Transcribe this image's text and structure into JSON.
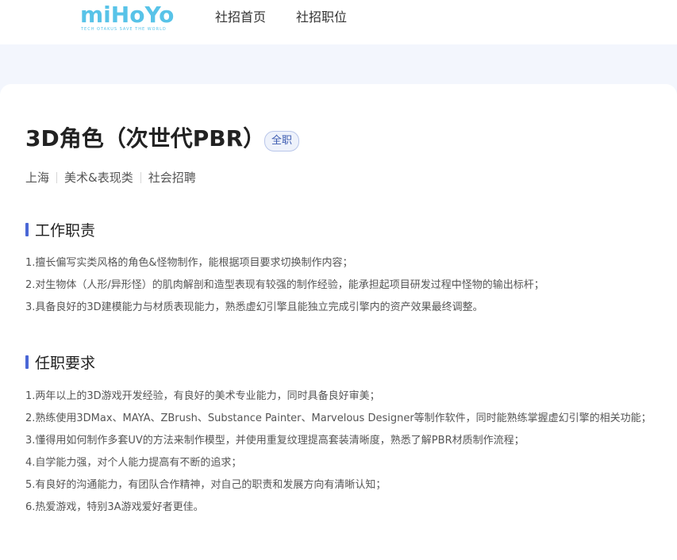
{
  "header": {
    "logo_text": "miHoYo",
    "logo_slogan": "TECH OTAKUS SAVE THE WORLD",
    "nav": [
      {
        "label": "社招首页"
      },
      {
        "label": "社招职位"
      }
    ]
  },
  "job": {
    "title": "3D角色（次世代PBR）",
    "badge": "全职",
    "meta": [
      "上海",
      "美术&表现类",
      "社会招聘"
    ]
  },
  "sections": [
    {
      "title": "工作职责",
      "items": [
        "1.擅长偏写实类风格的角色&怪物制作，能根据项目要求切换制作内容；",
        "2.对生物体（人形/异形怪）的肌肉解剖和造型表现有较强的制作经验，能承担起项目研发过程中怪物的输出标杆；",
        "3.具备良好的3D建模能力与材质表现能力，熟悉虚幻引擎且能独立完成引擎内的资产效果最终调整。"
      ]
    },
    {
      "title": "任职要求",
      "items": [
        "1.两年以上的3D游戏开发经验，有良好的美术专业能力，同时具备良好审美；",
        "2.熟练使用3DMax、MAYA、ZBrush、Substance Painter、Marvelous Designer等制作软件，同时能熟练掌握虚幻引擎的相关功能；",
        "3.懂得用如何制作多套UV的方法来制作模型，并使用重复纹理提高套装清晰度，熟悉了解PBR材质制作流程；",
        "4.自学能力强，对个人能力提高有不断的追求；",
        "5.有良好的沟通能力，有团队合作精神，对自己的职责和发展方向有清晰认知；",
        "6.热爱游戏，特别3A游戏爱好者更佳。"
      ]
    }
  ],
  "colors": {
    "logo": "#58c3e8",
    "accent_bar": "#4a67d6",
    "badge_text": "#3c5bb0",
    "page_bg": "#f3f6fd"
  }
}
